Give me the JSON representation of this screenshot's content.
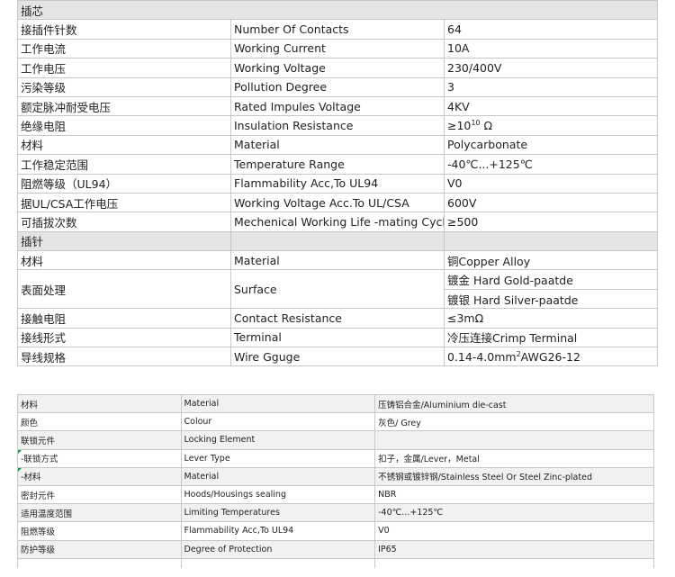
{
  "top_table": {
    "section1_title": "插芯",
    "section1_rows": [
      {
        "cn": "接插件针数",
        "en": "Number Of Contacts",
        "value": "64"
      },
      {
        "cn": "工作电流",
        "en": "Working Current",
        "value": "10A"
      },
      {
        "cn": "工作电压",
        "en": "Working Voltage",
        "value": "230/400V"
      },
      {
        "cn": "污染等级",
        "en": "Pollution Degree",
        "value": "3"
      },
      {
        "cn": "额定脉冲耐受电压",
        "en": "Rated Impules Voltage",
        "value": "4KV"
      },
      {
        "cn": "绝缘电阻",
        "en": "Insulation Resistance",
        "value_base": "≥10",
        "value_exp": "10",
        "value_unit": " Ω"
      },
      {
        "cn": "材料",
        "en": "Material",
        "value": "Polycarbonate"
      },
      {
        "cn": "工作稳定范围",
        "en": "Temperature Range",
        "value": "-40℃...+125℃"
      },
      {
        "cn": "阻燃等级（UL94）",
        "en": "Flammability Acc,To UL94",
        "value": "V0"
      },
      {
        "cn": "据UL/CSA工作电压",
        "en": "Working Voltage Acc.To UL/CSA",
        "value": "600V"
      },
      {
        "cn": "可插拔次数",
        "en": "Mechenical Working Life -mating Cycles",
        "value": "≥500"
      }
    ],
    "section2_title": "插针",
    "material": {
      "cn": "材料",
      "en": "Material",
      "value": "铜Copper Alloy"
    },
    "surface": {
      "cn": "表面处理",
      "en": "Surface",
      "value1": "镀金 Hard Gold-paatde",
      "value2": "镀银 Hard Silver-paatde"
    },
    "contact_resistance": {
      "cn": "接触电阻",
      "en": "Contact Resistance",
      "value": "≤3mΩ"
    },
    "terminal": {
      "cn": "接线形式",
      "en": "Terminal",
      "value": "冷压连接Crimp Terminal"
    },
    "wire": {
      "cn": "导线规格",
      "en": "Wire Gguge",
      "value_pre": "0.14-4.0mm",
      "value_sup": "2",
      "value_post": "AWG26-12"
    }
  },
  "bottom_table": {
    "rows": [
      {
        "cn": "材料",
        "en": "Material",
        "value": "压铸铝合金/Aluminium die-cast"
      },
      {
        "cn": "颜色",
        "en": "Colour",
        "value": "灰色/ Grey"
      },
      {
        "cn": "联锁元件",
        "en": "Locking Element",
        "value": ""
      },
      {
        "cn": "-联锁方式",
        "en": "Lever Type",
        "value": "扣子，金属/Lever，Metal"
      },
      {
        "cn": "-材料",
        "en": "Material",
        "value": "不锈钢或镀锌钢/Stainless Steel Or Steel Zinc-plated"
      },
      {
        "cn": "密封元件",
        "en": "Hoods/Housings sealing",
        "value": "NBR"
      },
      {
        "cn": "适用温度范围",
        "en": "Limiting Temperatures",
        "value": "-40℃...+125℃"
      },
      {
        "cn": "阻燃等级",
        "en": "Flammability Acc,To UL94",
        "value": "V0"
      },
      {
        "cn": "防护等级",
        "en": "Degree of Protection",
        "value": "IP65"
      }
    ]
  },
  "colors": {
    "header_bg": "#e4e4e4",
    "alt_bg": "#f1f1f1",
    "border": "#c8c8c8",
    "marker": "#1e9b3c"
  }
}
